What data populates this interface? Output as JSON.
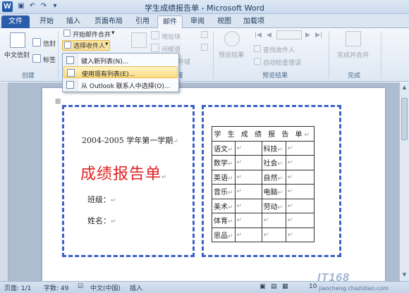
{
  "window": {
    "title": "学生成绩报告单 - Microsoft Word",
    "app_icon": "W"
  },
  "quick_access": [
    "save-icon",
    "undo-icon",
    "redo-icon",
    "customize-icon"
  ],
  "tabs": [
    "文件",
    "开始",
    "插入",
    "页面布局",
    "引用",
    "邮件",
    "审阅",
    "视图",
    "加载项"
  ],
  "active_tab": "邮件",
  "ribbon": {
    "create": {
      "chinese_envelope": "中文信封",
      "envelope": "信封",
      "label": "标签",
      "group": "创建"
    },
    "start_merge": {
      "start_mail_merge": "开始邮件合并",
      "select_recipients": "选择收件人"
    },
    "write_insert": {
      "address_block": "地址块",
      "greeting_line": "问候语",
      "group_fragment": "域",
      "open_fragment": "开域"
    },
    "preview": {
      "preview_results": "预览结果",
      "find_recipient": "查找收件人",
      "auto_check": "自动检查错误",
      "group": "预览结果"
    },
    "finish": {
      "finish_merge": "完成并合并",
      "group": "完成"
    }
  },
  "recipient_menu": [
    {
      "label": "键入新列表(N)..."
    },
    {
      "label": "使用现有列表(E)..."
    },
    {
      "label": "从 Outlook 联系人中选择(O)..."
    }
  ],
  "document": {
    "semester": "2004-2005 学年第一学期",
    "report_title": "成绩报告单",
    "class_label": "班级：",
    "name_label": "姓名：",
    "table_title": "学 生 成 绩 报 告 单",
    "rows": [
      [
        "语文",
        "科技"
      ],
      [
        "数学",
        "社会"
      ],
      [
        "英语",
        "自然"
      ],
      [
        "音乐",
        "电脑"
      ],
      [
        "美术",
        "劳动"
      ],
      [
        "体育",
        ""
      ],
      [
        "思品",
        ""
      ]
    ],
    "paragraph_mark": "↵"
  },
  "status": {
    "page": "页面: 1/1",
    "words": "字数: 49",
    "language": "中文(中国)",
    "insert": "插入",
    "zoom": "10"
  },
  "watermark": {
    "brand": "IT168",
    "url": "jiaocheng.chazidian.com"
  },
  "colors": {
    "report_title": "#e02020",
    "frame": "#3a5fc8",
    "file_tab": "#2a5caa"
  }
}
